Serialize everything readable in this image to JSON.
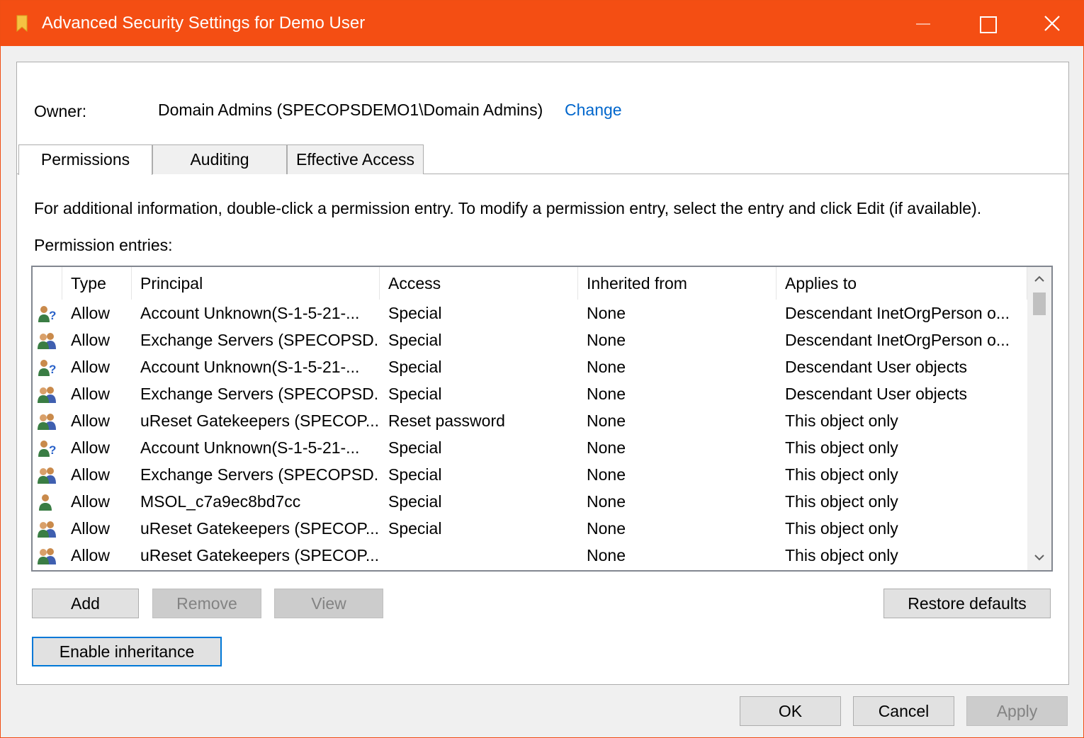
{
  "window": {
    "title": "Advanced Security Settings for Demo User",
    "accent_color": "#f44e13",
    "icons": {
      "app": "folder-icon",
      "minimize": "minimize-icon",
      "maximize": "maximize-icon",
      "close": "close-icon"
    }
  },
  "owner": {
    "label": "Owner:",
    "value": "Domain Admins (SPECOPSDEMO1\\Domain Admins)",
    "change_link": "Change"
  },
  "tabs": [
    {
      "label": "Permissions",
      "active": true
    },
    {
      "label": "Auditing",
      "active": false
    },
    {
      "label": "Effective Access",
      "active": false
    }
  ],
  "info_text": "For additional information, double-click a permission entry. To modify a permission entry, select the entry and click Edit (if available).",
  "entries_label": "Permission entries:",
  "columns": [
    "Type",
    "Principal",
    "Access",
    "Inherited from",
    "Applies to"
  ],
  "entries": [
    {
      "icon": "unknown-user-icon",
      "type": "Allow",
      "principal": "Account Unknown(S-1-5-21-...",
      "access": "Special",
      "inherited": "None",
      "applies": "Descendant InetOrgPerson o..."
    },
    {
      "icon": "group-icon",
      "type": "Allow",
      "principal": "Exchange Servers (SPECOPSD...",
      "access": "Special",
      "inherited": "None",
      "applies": "Descendant InetOrgPerson o..."
    },
    {
      "icon": "unknown-user-icon",
      "type": "Allow",
      "principal": "Account Unknown(S-1-5-21-...",
      "access": "Special",
      "inherited": "None",
      "applies": "Descendant User objects"
    },
    {
      "icon": "group-icon",
      "type": "Allow",
      "principal": "Exchange Servers (SPECOPSD...",
      "access": "Special",
      "inherited": "None",
      "applies": "Descendant User objects"
    },
    {
      "icon": "group-icon",
      "type": "Allow",
      "principal": "uReset Gatekeepers (SPECOP...",
      "access": "Reset password",
      "inherited": "None",
      "applies": "This object only"
    },
    {
      "icon": "unknown-user-icon",
      "type": "Allow",
      "principal": "Account Unknown(S-1-5-21-...",
      "access": "Special",
      "inherited": "None",
      "applies": "This object only"
    },
    {
      "icon": "group-icon",
      "type": "Allow",
      "principal": "Exchange Servers (SPECOPSD...",
      "access": "Special",
      "inherited": "None",
      "applies": "This object only"
    },
    {
      "icon": "user-icon",
      "type": "Allow",
      "principal": "MSOL_c7a9ec8bd7cc",
      "access": "Special",
      "inherited": "None",
      "applies": "This object only"
    },
    {
      "icon": "group-icon",
      "type": "Allow",
      "principal": "uReset Gatekeepers (SPECOP...",
      "access": "Special",
      "inherited": "None",
      "applies": "This object only"
    },
    {
      "icon": "group-icon",
      "type": "Allow",
      "principal": "uReset Gatekeepers (SPECOP...",
      "access": "",
      "inherited": "None",
      "applies": "This object only"
    }
  ],
  "buttons": {
    "add": "Add",
    "remove": "Remove",
    "view": "View",
    "restore_defaults": "Restore defaults",
    "enable_inheritance": "Enable inheritance",
    "ok": "OK",
    "cancel": "Cancel",
    "apply": "Apply"
  }
}
